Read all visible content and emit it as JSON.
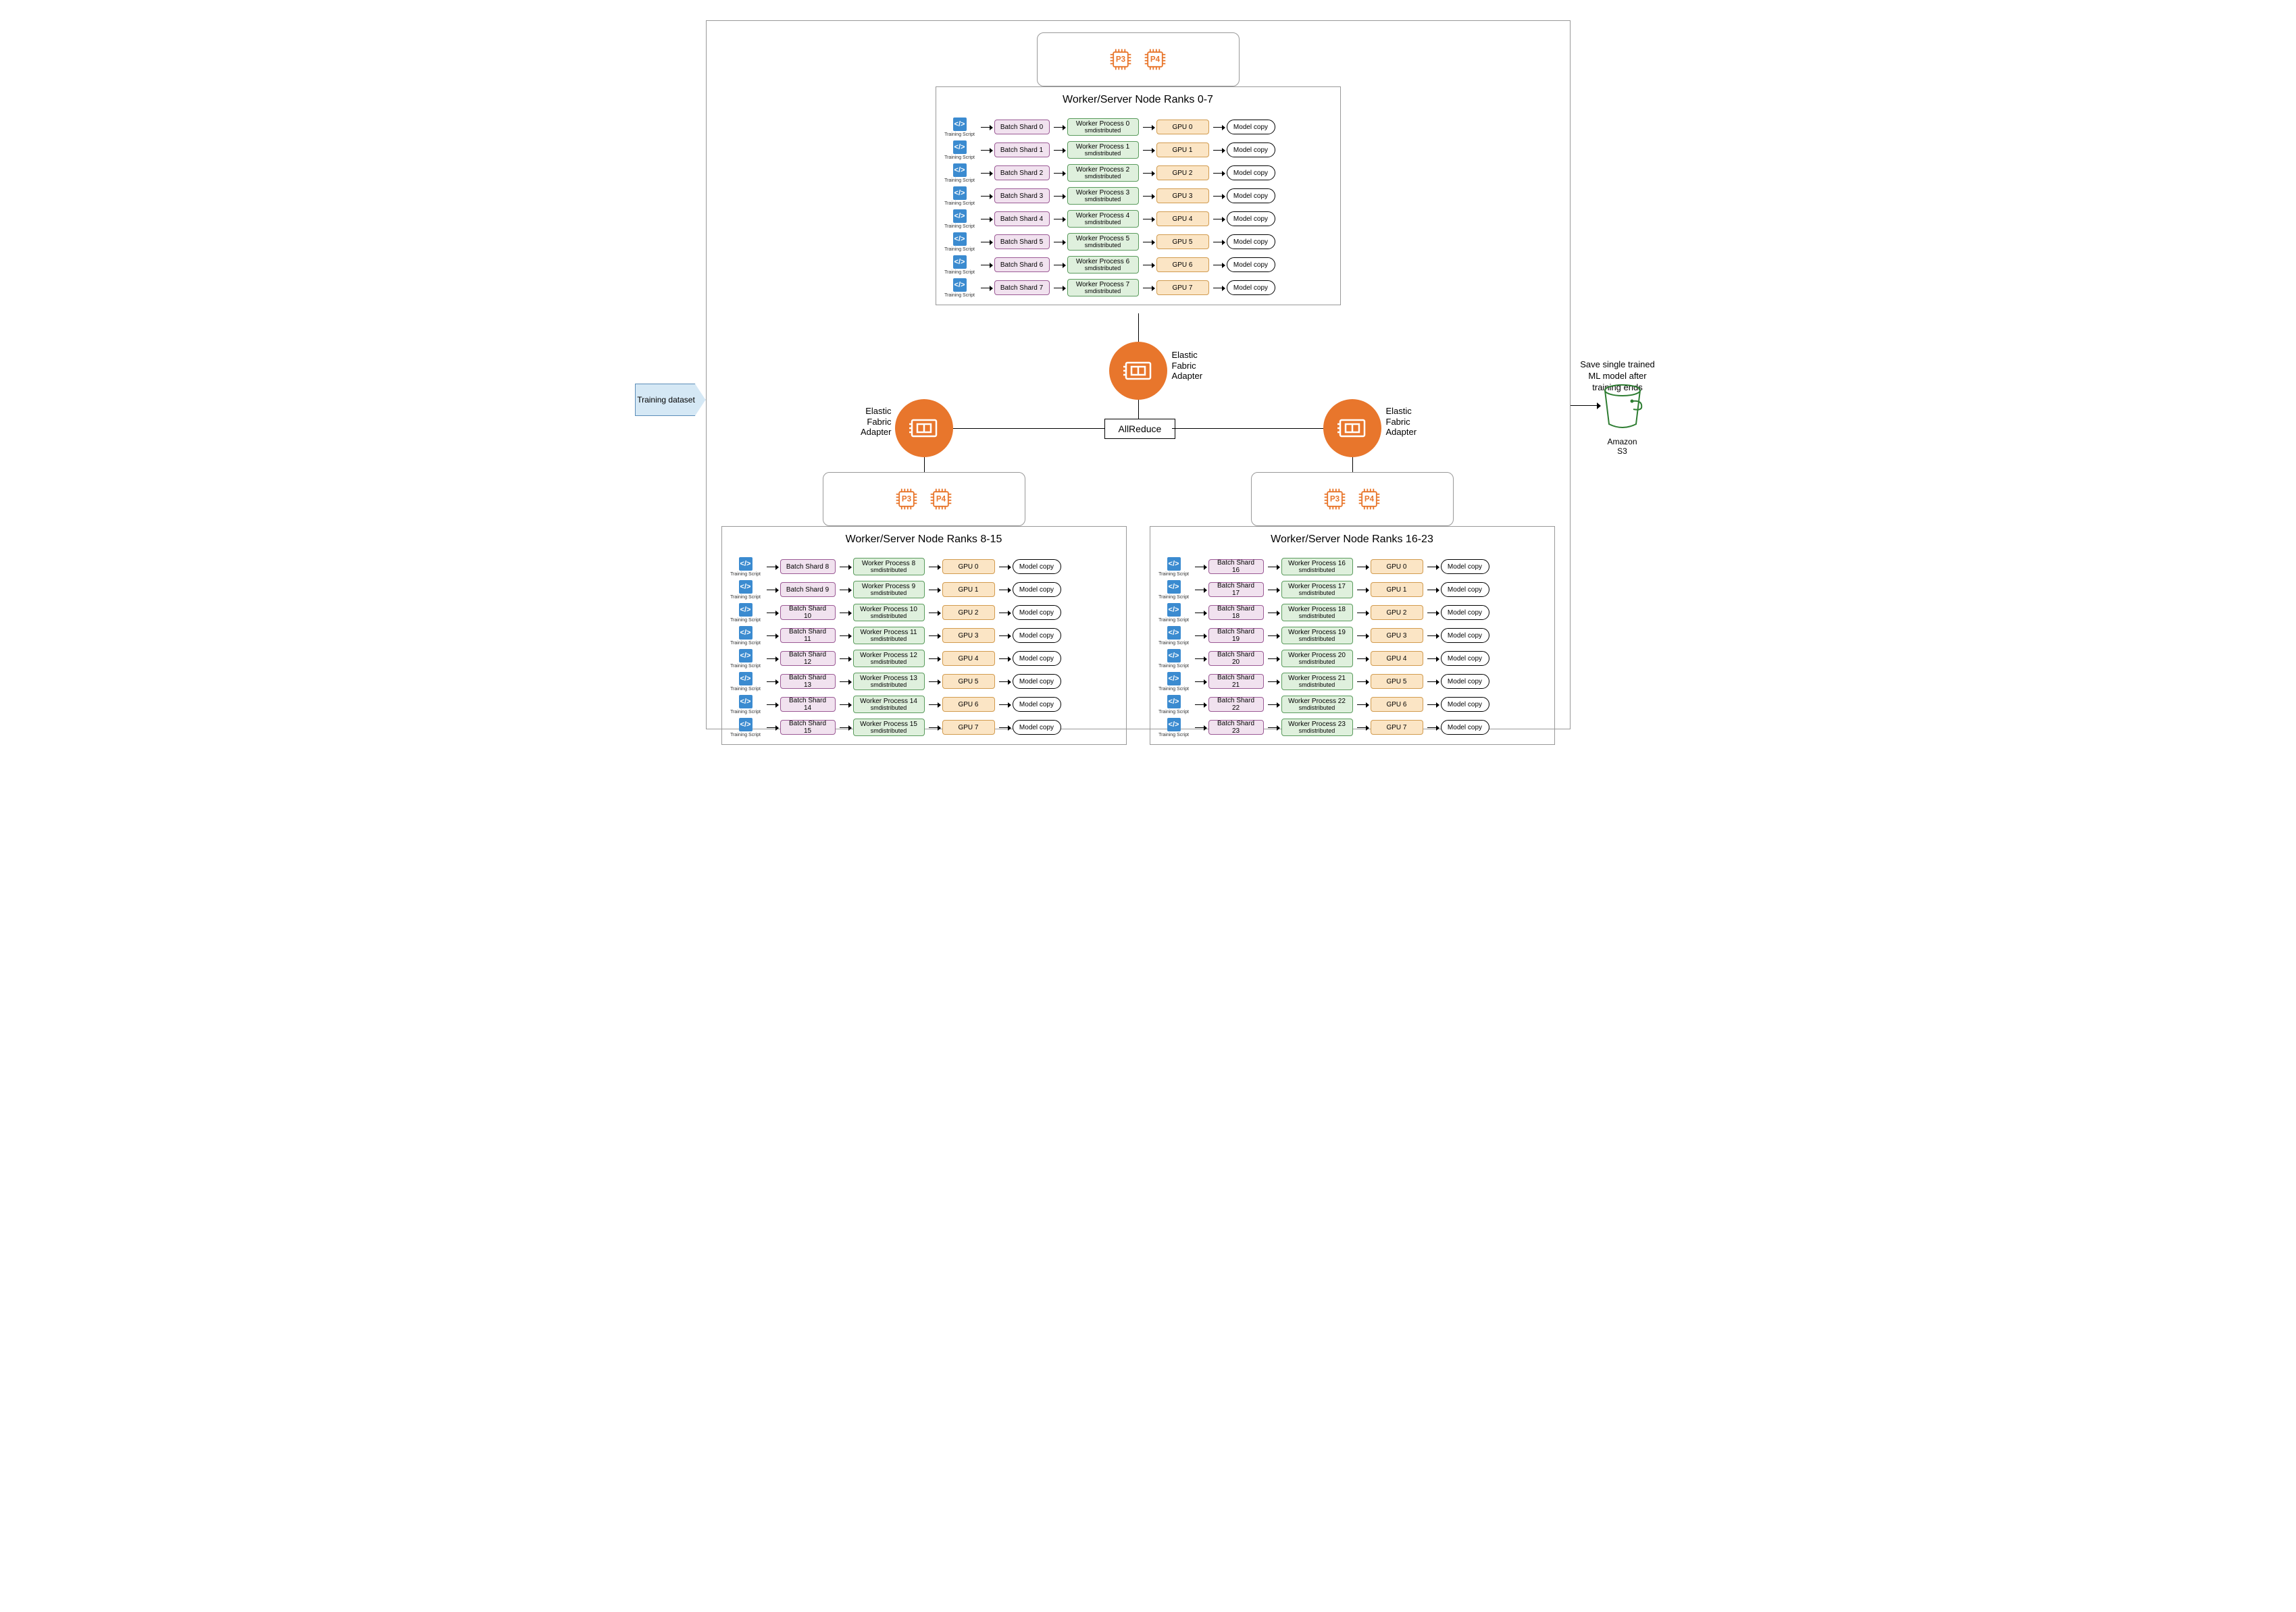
{
  "input": {
    "label": "Training dataset"
  },
  "cpu_labels": [
    "P3",
    "P4"
  ],
  "efa_label": "Elastic Fabric Adapter",
  "allreduce": "AllReduce",
  "script_label": "Training Script",
  "model_copy": "Model copy",
  "smdist": "smdistributed",
  "output": {
    "caption": "Save single trained ML model after training ends",
    "target": "Amazon S3"
  },
  "nodes": [
    {
      "title": "Worker/Server Node Ranks 0-7",
      "rows": [
        {
          "shard": "Batch Shard 0",
          "worker": "Worker Process 0",
          "gpu": "GPU 0"
        },
        {
          "shard": "Batch Shard 1",
          "worker": "Worker Process 1",
          "gpu": "GPU 1"
        },
        {
          "shard": "Batch Shard 2",
          "worker": "Worker Process 2",
          "gpu": "GPU 2"
        },
        {
          "shard": "Batch Shard 3",
          "worker": "Worker Process 3",
          "gpu": "GPU 3"
        },
        {
          "shard": "Batch Shard 4",
          "worker": "Worker Process 4",
          "gpu": "GPU 4"
        },
        {
          "shard": "Batch Shard 5",
          "worker": "Worker Process 5",
          "gpu": "GPU 5"
        },
        {
          "shard": "Batch Shard 6",
          "worker": "Worker Process 6",
          "gpu": "GPU 6"
        },
        {
          "shard": "Batch Shard 7",
          "worker": "Worker Process 7",
          "gpu": "GPU 7"
        }
      ]
    },
    {
      "title": "Worker/Server Node Ranks 8-15",
      "rows": [
        {
          "shard": "Batch Shard 8",
          "worker": "Worker Process 8",
          "gpu": "GPU 0"
        },
        {
          "shard": "Batch Shard 9",
          "worker": "Worker Process 9",
          "gpu": "GPU 1"
        },
        {
          "shard": "Batch Shard 10",
          "worker": "Worker Process 10",
          "gpu": "GPU 2"
        },
        {
          "shard": "Batch Shard 11",
          "worker": "Worker Process 11",
          "gpu": "GPU 3"
        },
        {
          "shard": "Batch Shard 12",
          "worker": "Worker Process 12",
          "gpu": "GPU 4"
        },
        {
          "shard": "Batch Shard 13",
          "worker": "Worker Process 13",
          "gpu": "GPU 5"
        },
        {
          "shard": "Batch Shard 14",
          "worker": "Worker Process 14",
          "gpu": "GPU 6"
        },
        {
          "shard": "Batch Shard 15",
          "worker": "Worker Process 15",
          "gpu": "GPU 7"
        }
      ]
    },
    {
      "title": "Worker/Server Node Ranks 16-23",
      "rows": [
        {
          "shard": "Batch Shard 16",
          "worker": "Worker Process 16",
          "gpu": "GPU 0"
        },
        {
          "shard": "Batch Shard 17",
          "worker": "Worker Process 17",
          "gpu": "GPU 1"
        },
        {
          "shard": "Batch Shard 18",
          "worker": "Worker Process 18",
          "gpu": "GPU 2"
        },
        {
          "shard": "Batch Shard 19",
          "worker": "Worker Process 19",
          "gpu": "GPU 3"
        },
        {
          "shard": "Batch Shard 20",
          "worker": "Worker Process 20",
          "gpu": "GPU 4"
        },
        {
          "shard": "Batch Shard 21",
          "worker": "Worker Process 21",
          "gpu": "GPU 5"
        },
        {
          "shard": "Batch Shard 22",
          "worker": "Worker Process 22",
          "gpu": "GPU 6"
        },
        {
          "shard": "Batch Shard 23",
          "worker": "Worker Process 23",
          "gpu": "GPU 7"
        }
      ]
    }
  ]
}
